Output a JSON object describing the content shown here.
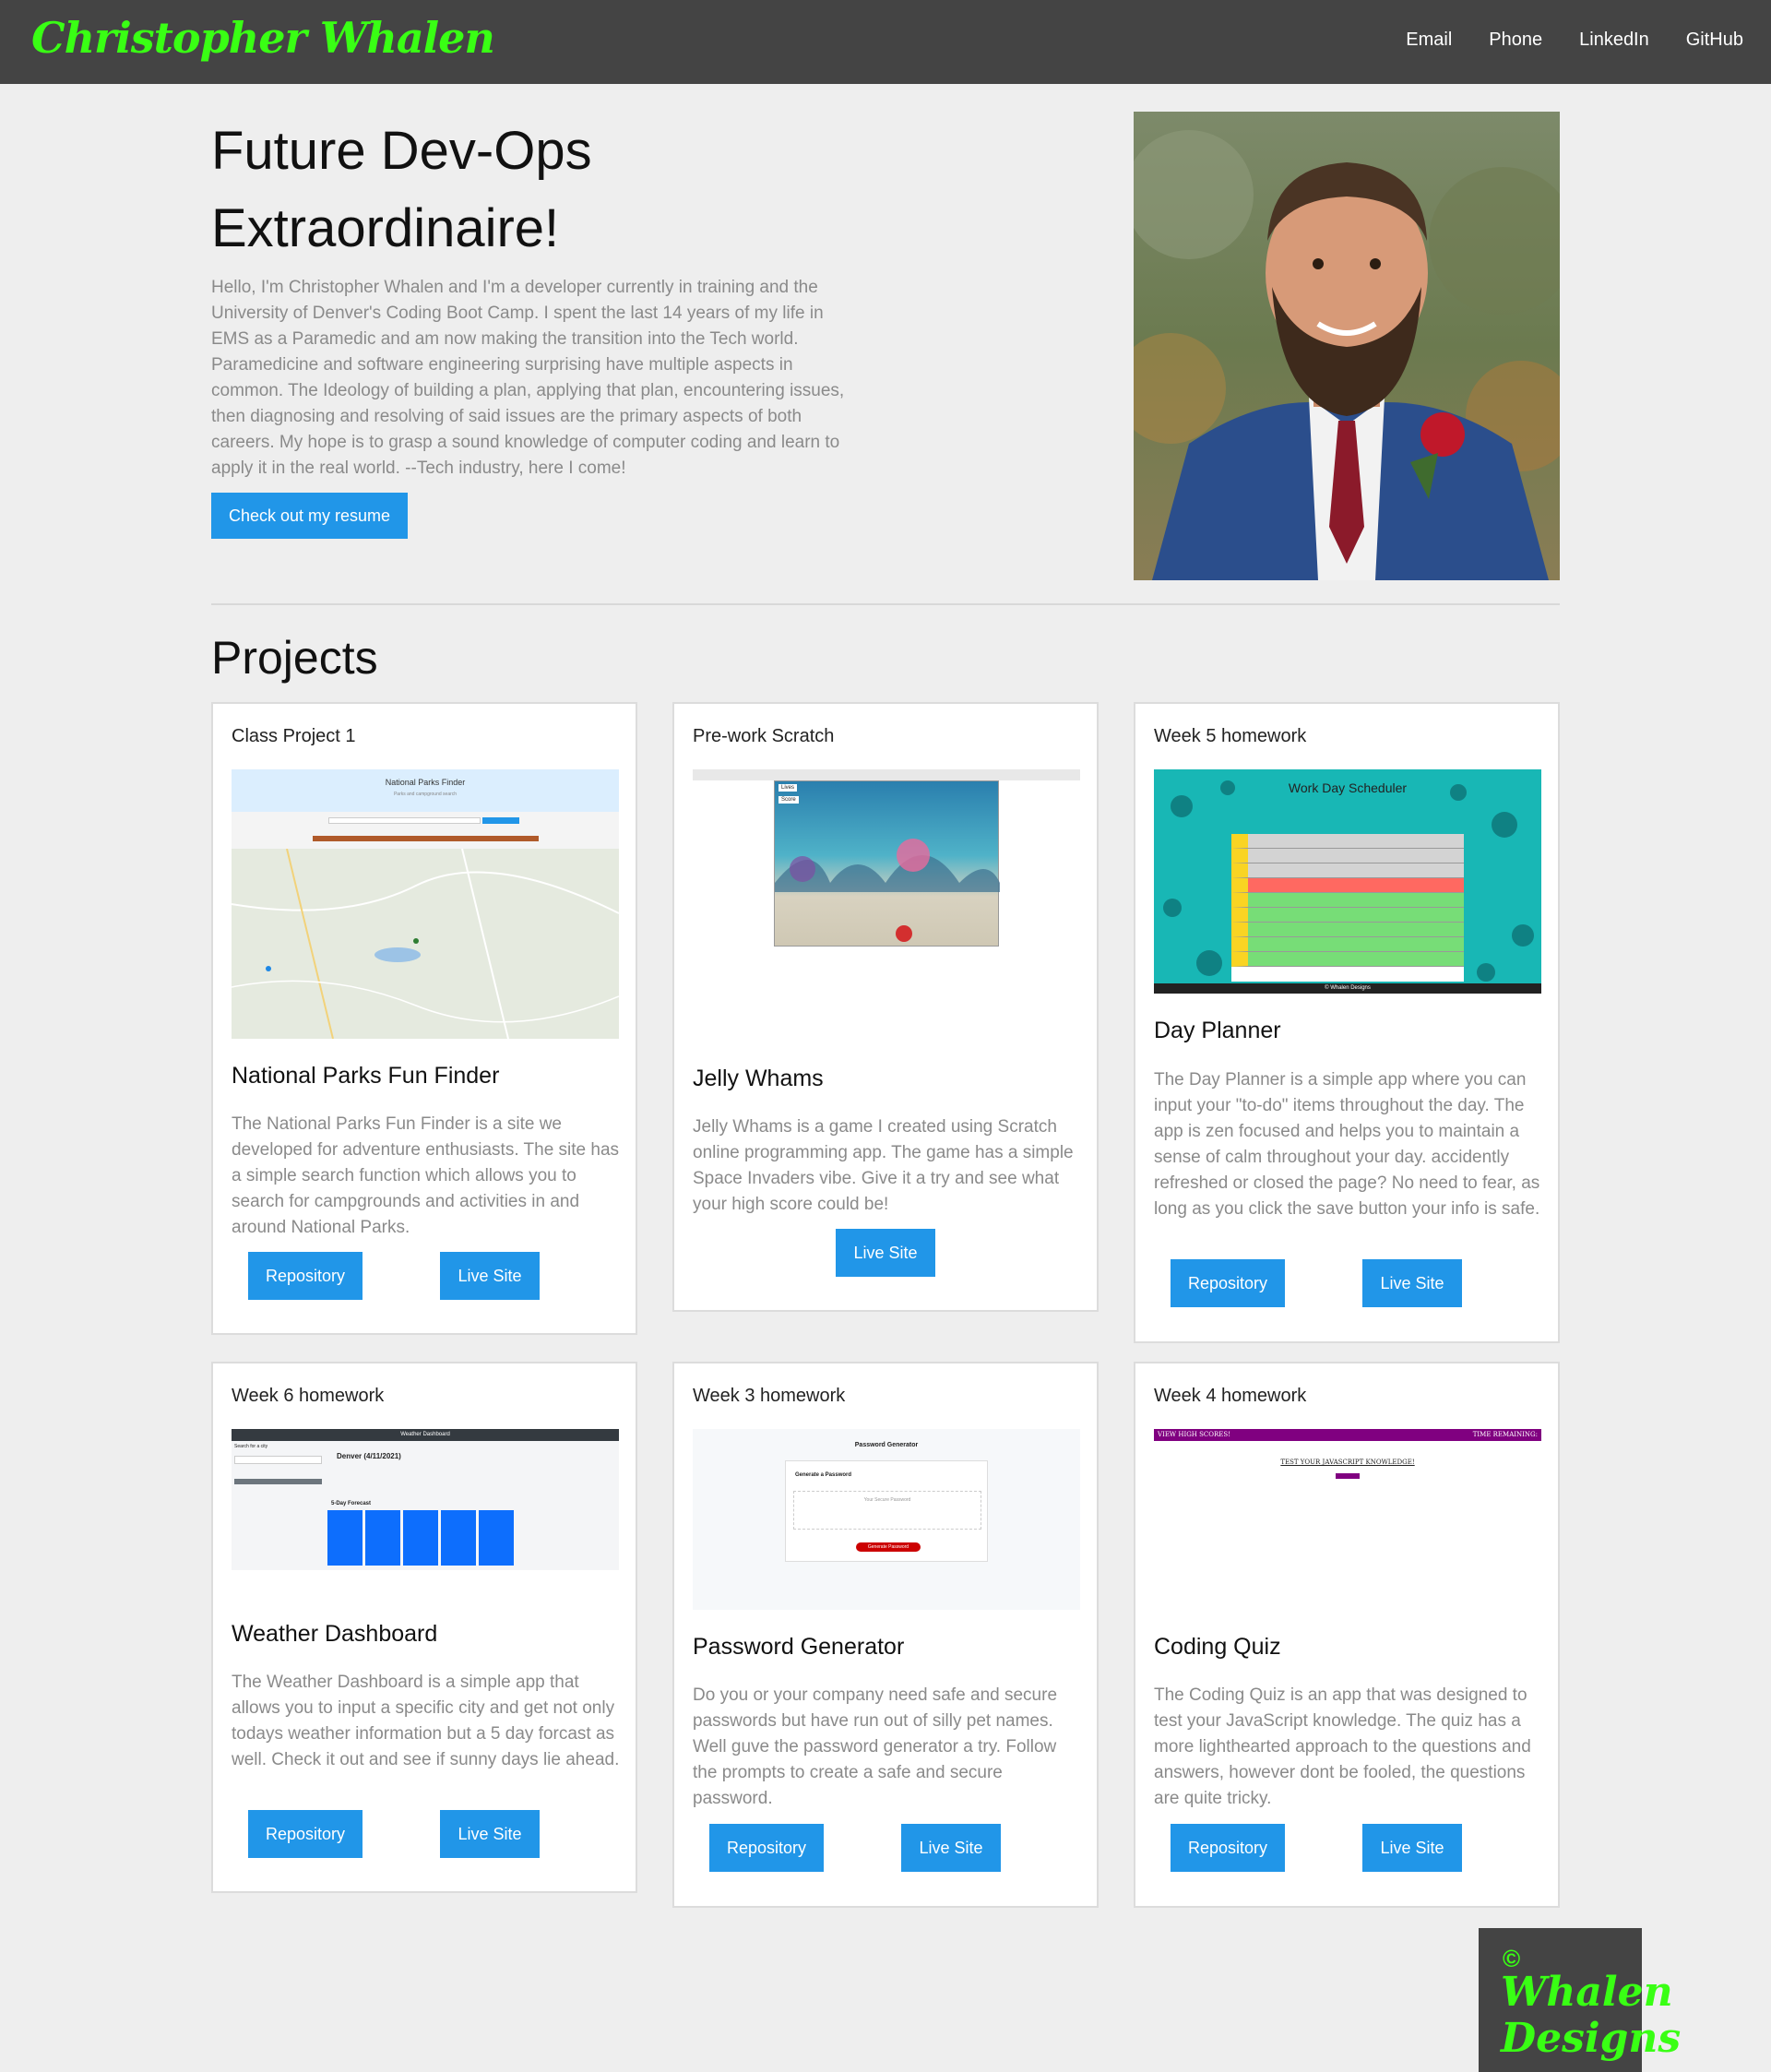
{
  "header": {
    "brand": "Christopher Whalen",
    "nav": [
      "Email",
      "Phone",
      "LinkedIn",
      "GitHub"
    ]
  },
  "hero": {
    "title_line1": "Future Dev-Ops",
    "title_line2": "Extraordinaire!",
    "intro": "Hello, I'm Christopher Whalen and I'm a developer currently in training and the University of Denver's Coding Boot Camp. I spent the last 14 years of my life in EMS as a Paramedic and am now making the transition into the Tech world. Paramedicine and software engineering surprising have multiple aspects in common. The Ideology of building a plan, applying that plan, encountering issues, then diagnosing and resolving of said issues are the primary aspects of both careers. My hope is to grasp a sound knowledge of computer coding and learn to apply it in the real world. --Tech industry, here I come!",
    "resume_button": "Check out my resume"
  },
  "projects_heading": "Projects",
  "projects": [
    {
      "label": "Class Project 1",
      "title": "National Parks Fun Finder",
      "description": "The National Parks Fun Finder is a site we developed for adventure enthusiasts. The site has a simple search function which allows you to search for campgrounds and activities in and around National Parks.",
      "repo": "Repository",
      "live": "Live Site",
      "shot": {
        "heading": "National Parks Finder",
        "sub": "Parks and campground search"
      }
    },
    {
      "label": "Pre-work Scratch",
      "title": "Jelly Whams",
      "description": "Jelly Whams is a game I created using Scratch online programming app. The game has a simple Space Invaders vibe. Give it a try and see what your high score could be!",
      "live": "Live Site",
      "shot": {
        "lives": "Lives",
        "score": "Score"
      }
    },
    {
      "label": "Week 5 homework",
      "title": "Day Planner",
      "description": "The Day Planner is a simple app where you can input your \"to-do\" items throughout the day. The app is zen focused and helps you to maintain a sense of calm throughout your day. accidently refreshed or closed the page? No need to fear, as long as you click the save button your info is safe.",
      "repo": "Repository",
      "live": "Live Site",
      "shot": {
        "heading": "Work Day Scheduler",
        "footer": "© Whalen Designs"
      }
    },
    {
      "label": "Week 6 homework",
      "title": "Weather Dashboard",
      "description": "The Weather Dashboard is a simple app that allows you to input a specific city and get not only todays weather information but a 5 day forcast as well. Check it out and see if sunny days lie ahead.",
      "repo": "Repository",
      "live": "Live Site",
      "shot": {
        "heading": "Weather Dashboard",
        "city": "Denver (4/11/2021)",
        "forecast": "5-Day Forecast",
        "search": "Search for a city"
      }
    },
    {
      "label": "Week 3 homework",
      "title": "Password Generator",
      "description": "Do you or your company need safe and secure passwords but have run out of silly pet names. Well guve the password generator a try. Follow the prompts to create a safe and secure password.",
      "repo": "Repository",
      "live": "Live Site",
      "shot": {
        "heading": "Password Generator",
        "sub": "Generate a Password",
        "placeholder": "Your Secure Password",
        "button": "Generate Password"
      }
    },
    {
      "label": "Week 4 homework",
      "title": "Coding Quiz",
      "description": "The Coding Quiz is an app that was designed to test your JavaScript knowledge. The quiz has a more lighthearted approach to the questions and answers, however dont be fooled, the questions are quite tricky.",
      "repo": "Repository",
      "live": "Live Site",
      "shot": {
        "left": "VIEW HIGH SCORES!",
        "right": "TIME REMAINING:",
        "heading": "TEST YOUR JAVASCRIPT KNOWLEDGE!"
      }
    }
  ],
  "footer": {
    "copyright": "©",
    "line1": "Whalen",
    "line2": "Designs"
  },
  "colors": {
    "accent": "#2196e8",
    "brand": "#39ff14",
    "header": "#444444"
  }
}
